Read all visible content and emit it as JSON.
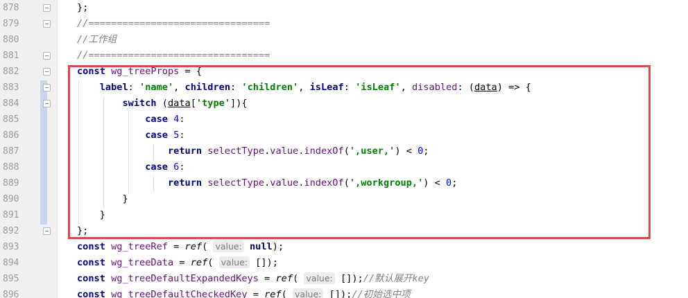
{
  "lines": [
    {
      "n": "878",
      "fold": "minus",
      "tokens": [
        [
          "p",
          "};"
        ]
      ]
    },
    {
      "n": "879",
      "fold": "minus",
      "tokens": [
        [
          "cm",
          "//================================"
        ]
      ]
    },
    {
      "n": "880",
      "fold": "",
      "tokens": [
        [
          "cm",
          "//工作组"
        ]
      ]
    },
    {
      "n": "881",
      "fold": "minus",
      "tokens": [
        [
          "cm",
          "//================================"
        ]
      ]
    },
    {
      "n": "882",
      "fold": "minus",
      "tokens": [
        [
          "kw",
          "const"
        ],
        [
          "p",
          " "
        ],
        [
          "prop",
          "wg_treeProps"
        ],
        [
          "p",
          " = {"
        ]
      ]
    },
    {
      "n": "883",
      "fold": "minus",
      "tokens": [
        [
          "p",
          "    "
        ],
        [
          "kw",
          "label"
        ],
        [
          "p",
          ": "
        ],
        [
          "str",
          "'name'"
        ],
        [
          "p",
          ", "
        ],
        [
          "kw",
          "children"
        ],
        [
          "p",
          ": "
        ],
        [
          "str",
          "'children'"
        ],
        [
          "p",
          ", "
        ],
        [
          "kw",
          "isLeaf"
        ],
        [
          "p",
          ": "
        ],
        [
          "str",
          "'isLeaf'"
        ],
        [
          "p",
          ", "
        ],
        [
          "prop",
          "disabled"
        ],
        [
          "p",
          ": ("
        ],
        [
          "param",
          "data"
        ],
        [
          "p",
          ") => {"
        ]
      ]
    },
    {
      "n": "884",
      "fold": "minus",
      "tokens": [
        [
          "p",
          "        "
        ],
        [
          "kw",
          "switch"
        ],
        [
          "p",
          " ("
        ],
        [
          "param",
          "data"
        ],
        [
          "p",
          "["
        ],
        [
          "str",
          "'type'"
        ],
        [
          "p",
          "]){"
        ]
      ]
    },
    {
      "n": "885",
      "fold": "",
      "tokens": [
        [
          "p",
          "            "
        ],
        [
          "kw",
          "case"
        ],
        [
          "p",
          " "
        ],
        [
          "num",
          "4"
        ],
        [
          "p",
          ":"
        ]
      ]
    },
    {
      "n": "886",
      "fold": "",
      "tokens": [
        [
          "p",
          "            "
        ],
        [
          "kw",
          "case"
        ],
        [
          "p",
          " "
        ],
        [
          "num",
          "5"
        ],
        [
          "p",
          ":"
        ]
      ]
    },
    {
      "n": "887",
      "fold": "",
      "tokens": [
        [
          "p",
          "                "
        ],
        [
          "kw",
          "return"
        ],
        [
          "p",
          " "
        ],
        [
          "prop",
          "selectType"
        ],
        [
          "p",
          "."
        ],
        [
          "prop",
          "value"
        ],
        [
          "p",
          "."
        ],
        [
          "prop",
          "indexOf"
        ],
        [
          "p",
          "("
        ],
        [
          "str",
          "',user,'"
        ],
        [
          "p",
          ") < "
        ],
        [
          "num",
          "0"
        ],
        [
          "p",
          ";"
        ]
      ]
    },
    {
      "n": "888",
      "fold": "",
      "tokens": [
        [
          "p",
          "            "
        ],
        [
          "kw",
          "case"
        ],
        [
          "p",
          " "
        ],
        [
          "num",
          "6"
        ],
        [
          "p",
          ":"
        ]
      ]
    },
    {
      "n": "889",
      "fold": "",
      "tokens": [
        [
          "p",
          "                "
        ],
        [
          "kw",
          "return"
        ],
        [
          "p",
          " "
        ],
        [
          "prop",
          "selectType"
        ],
        [
          "p",
          "."
        ],
        [
          "prop",
          "value"
        ],
        [
          "p",
          "."
        ],
        [
          "prop",
          "indexOf"
        ],
        [
          "p",
          "("
        ],
        [
          "str",
          "',workgroup,'"
        ],
        [
          "p",
          ") < "
        ],
        [
          "num",
          "0"
        ],
        [
          "p",
          ";"
        ]
      ]
    },
    {
      "n": "890",
      "fold": "",
      "tokens": [
        [
          "p",
          "        }"
        ]
      ]
    },
    {
      "n": "891",
      "fold": "",
      "tokens": [
        [
          "p",
          "    }"
        ]
      ]
    },
    {
      "n": "892",
      "fold": "minus",
      "tokens": [
        [
          "p",
          "};"
        ]
      ]
    },
    {
      "n": "893",
      "fold": "",
      "tokens": [
        [
          "kw",
          "const"
        ],
        [
          "p",
          " "
        ],
        [
          "prop",
          "wg_treeRef"
        ],
        [
          "p",
          " = "
        ],
        [
          "fn",
          "ref"
        ],
        [
          "p",
          "( "
        ],
        [
          "hint",
          "value:"
        ],
        [
          "p",
          " "
        ],
        [
          "kw",
          "null"
        ],
        [
          "p",
          ");"
        ]
      ]
    },
    {
      "n": "894",
      "fold": "",
      "tokens": [
        [
          "kw",
          "const"
        ],
        [
          "p",
          " "
        ],
        [
          "prop",
          "wg_treeData"
        ],
        [
          "p",
          " = "
        ],
        [
          "fn",
          "ref"
        ],
        [
          "p",
          "( "
        ],
        [
          "hint",
          "value:"
        ],
        [
          "p",
          " []);"
        ]
      ]
    },
    {
      "n": "895",
      "fold": "",
      "tokens": [
        [
          "kw",
          "const"
        ],
        [
          "p",
          " "
        ],
        [
          "prop",
          "wg_treeDefaultExpandedKeys"
        ],
        [
          "p",
          " = "
        ],
        [
          "fn",
          "ref"
        ],
        [
          "p",
          "( "
        ],
        [
          "hint",
          "value:"
        ],
        [
          "p",
          " []);"
        ],
        [
          "cm",
          "//默认展开key"
        ]
      ]
    },
    {
      "n": "896",
      "fold": "",
      "tokens": [
        [
          "kw",
          "const"
        ],
        [
          "p",
          " "
        ],
        [
          "prop",
          "wg_treeDefaultCheckedKey"
        ],
        [
          "p",
          " = "
        ],
        [
          "fn",
          "ref"
        ],
        [
          "p",
          "( "
        ],
        [
          "hint",
          "value:"
        ],
        [
          "p",
          " []);"
        ],
        [
          "cm",
          "//初始选中项"
        ]
      ]
    }
  ],
  "annotation": {
    "color": "#e0474d",
    "label": "highlighted wg_treeProps block"
  }
}
